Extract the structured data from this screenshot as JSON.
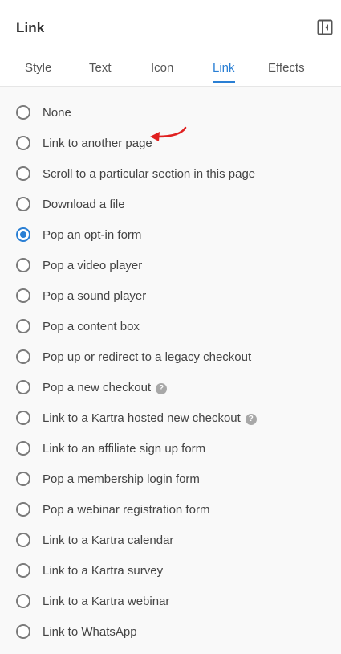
{
  "panel": {
    "title": "Link"
  },
  "tabs": [
    {
      "label": "Style",
      "active": false
    },
    {
      "label": "Text",
      "active": false
    },
    {
      "label": "Icon",
      "active": false
    },
    {
      "label": "Link",
      "active": true
    },
    {
      "label": "Effects",
      "active": false
    }
  ],
  "options": [
    {
      "label": "None",
      "checked": false
    },
    {
      "label": "Link to another page",
      "checked": false
    },
    {
      "label": "Scroll to a particular section in this page",
      "checked": false
    },
    {
      "label": "Download a file",
      "checked": false
    },
    {
      "label": "Pop an opt-in form",
      "checked": true
    },
    {
      "label": "Pop a video player",
      "checked": false
    },
    {
      "label": "Pop a sound player",
      "checked": false
    },
    {
      "label": "Pop a content box",
      "checked": false
    },
    {
      "label": "Pop up or redirect to a legacy checkout",
      "checked": false
    },
    {
      "label": "Pop a new checkout",
      "checked": false,
      "help": "?"
    },
    {
      "label": "Link to a Kartra hosted new checkout",
      "checked": false,
      "help": "?"
    },
    {
      "label": "Link to an affiliate sign up form",
      "checked": false
    },
    {
      "label": "Pop a membership login form",
      "checked": false
    },
    {
      "label": "Pop a webinar registration form",
      "checked": false
    },
    {
      "label": "Link to a Kartra calendar",
      "checked": false
    },
    {
      "label": "Link to a Kartra survey",
      "checked": false
    },
    {
      "label": "Link to a Kartra webinar",
      "checked": false
    },
    {
      "label": "Link to WhatsApp",
      "checked": false
    }
  ],
  "colors": {
    "accent": "#2a7fd4",
    "annotation_arrow": "#e02020"
  }
}
